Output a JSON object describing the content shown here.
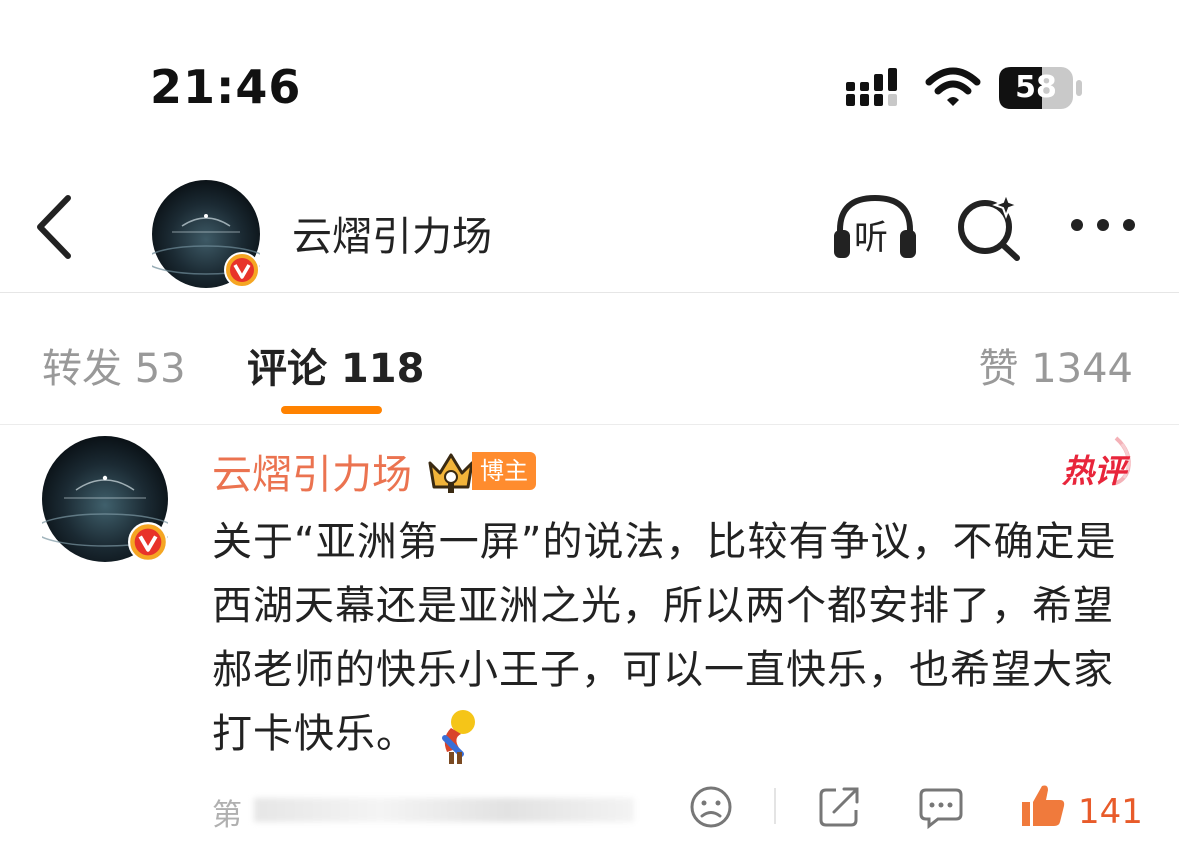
{
  "status_bar": {
    "time": "21:46",
    "battery": "58",
    "icons": [
      "signal-icon",
      "wifi-icon",
      "battery-icon"
    ]
  },
  "nav": {
    "title": "云熠引力场",
    "listen_label": "听",
    "icons": [
      "back-icon",
      "listen-icon",
      "search-ai-icon",
      "more-icon"
    ]
  },
  "tabs": [
    {
      "label": "转发 53"
    },
    {
      "label": "评论 118",
      "active": true
    },
    {
      "label": "赞 1344"
    }
  ],
  "comment": {
    "author": "云熠引力场",
    "badge": "博主",
    "hot_label": "热评",
    "text": "关于“亚洲第一屏”的说法，比较有争议，不确定是西湖天幕还是亚洲之光，所以两个都安排了，希望郝老师的快乐小王子，可以一直快乐，也希望大家打卡快乐。",
    "meta_prefix": "第",
    "like_count": "141"
  },
  "colors": {
    "accent": "#ff8200",
    "author_name": "#eb7350",
    "hot": "#e8253b",
    "verified": "#f5a623"
  }
}
